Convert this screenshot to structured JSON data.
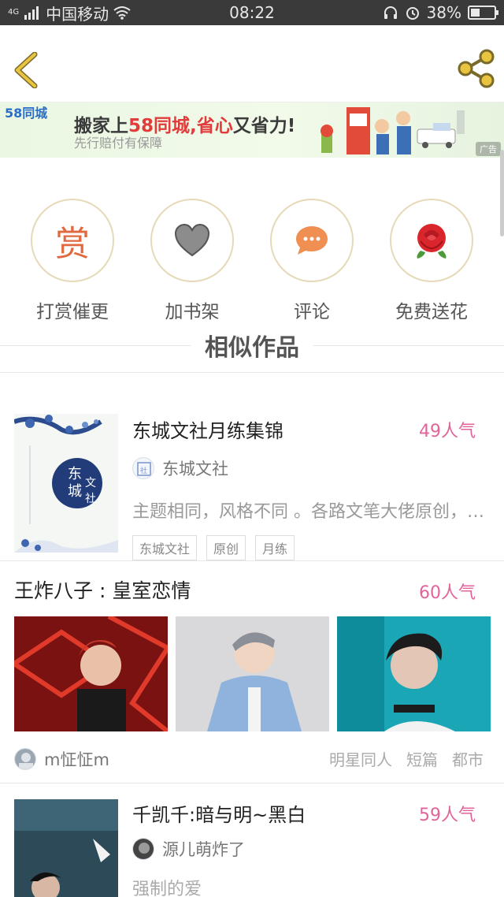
{
  "status_bar": {
    "network": "4G",
    "carrier": "中国移动",
    "time": "08:22",
    "battery": "38%",
    "battery_level": 0.38
  },
  "nav": {
    "back_icon": "back-chevron-icon",
    "share_icon": "share-icon"
  },
  "ad": {
    "logo": "58同城",
    "headline_prefix": "搬家上",
    "headline_brand": "58同城,",
    "headline_red2": "省心",
    "headline_suffix": "又省力!",
    "subline": "先行赔付有保障",
    "ad_tag": "广告"
  },
  "actions": [
    {
      "label": "打赏催更",
      "icon_text": "赏",
      "icon": "reward-icon"
    },
    {
      "label": "加书架",
      "icon": "heart-icon"
    },
    {
      "label": "评论",
      "icon": "comment-bubble-icon"
    },
    {
      "label": "免费送花",
      "icon": "rose-icon"
    }
  ],
  "section_title": "相似作品",
  "works": [
    {
      "title": "东城文社月练集锦",
      "popularity": "49人气",
      "author": "东城文社",
      "description": "主题相同，风格不同 。各路文笔大佬原创，欢迎阅读",
      "tags": [
        "东城文社",
        "原创",
        "月练"
      ]
    },
    {
      "title": "王炸八子 : 皇室恋情",
      "popularity": "60人气",
      "author": "m怔怔m",
      "genres": [
        "明星同人",
        "短篇",
        "都市"
      ]
    },
    {
      "title": "千凯千:暗与明~黑白",
      "popularity": "59人气",
      "author": "源儿萌炸了",
      "description": "强制的爱"
    }
  ],
  "colors": {
    "accent_pink": "#e0649a",
    "reward_orange": "#e2693f",
    "back_yellow": "#e8c440"
  }
}
